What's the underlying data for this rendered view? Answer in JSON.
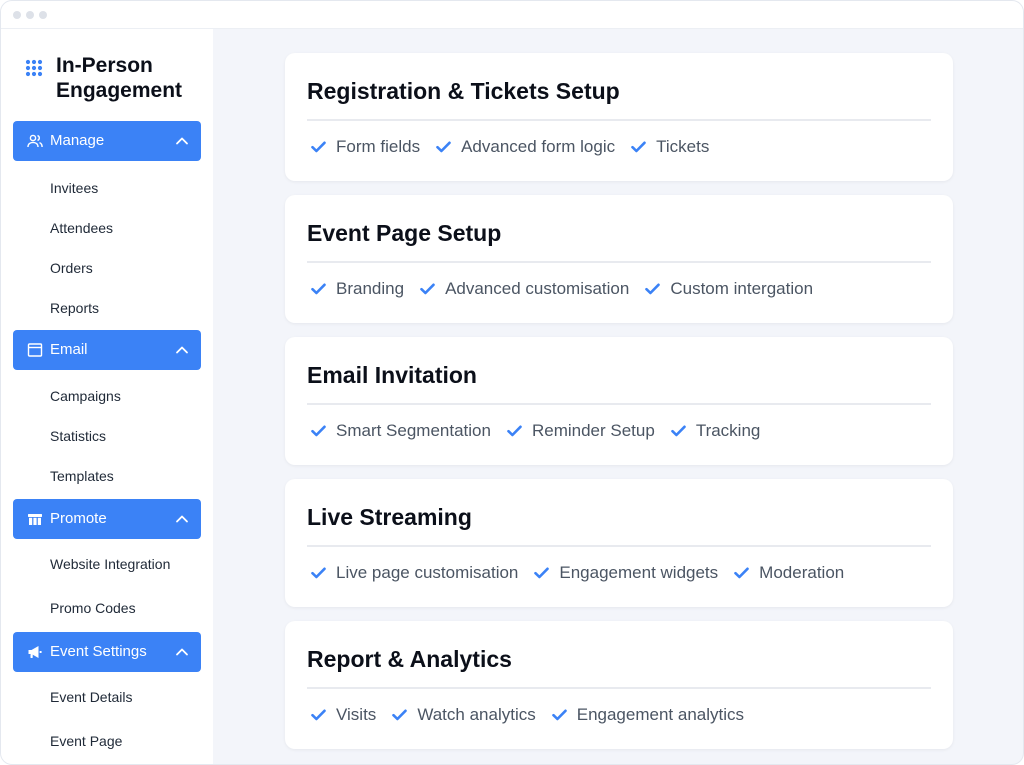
{
  "app": {
    "title": "In-Person Engagement",
    "accent_color": "#3b82f6",
    "check_color": "#3b82f6"
  },
  "sidebar": {
    "sections": [
      {
        "label": "Manage",
        "icon": "users-icon",
        "items": [
          "Invitees",
          "Attendees",
          "Orders",
          "Reports"
        ]
      },
      {
        "label": "Email",
        "icon": "browser-window-icon",
        "items": [
          "Campaigns",
          "Statistics",
          "Templates"
        ]
      },
      {
        "label": "Promote",
        "icon": "store-icon",
        "items": [
          "Website Integration",
          "Promo Codes"
        ]
      },
      {
        "label": "Event Settings",
        "icon": "megaphone-icon",
        "items": [
          "Event Details",
          "Event Page"
        ]
      }
    ]
  },
  "main": {
    "cards": [
      {
        "title": "Registration & Tickets Setup",
        "features": [
          "Form fields",
          "Advanced form logic",
          "Tickets"
        ]
      },
      {
        "title": "Event Page Setup",
        "features": [
          "Branding",
          "Advanced customisation",
          "Custom intergation"
        ]
      },
      {
        "title": "Email Invitation",
        "features": [
          "Smart Segmentation",
          "Reminder Setup",
          "Tracking"
        ]
      },
      {
        "title": "Live Streaming",
        "features": [
          "Live page customisation",
          "Engagement widgets",
          "Moderation"
        ]
      },
      {
        "title": "Report & Analytics",
        "features": [
          "Visits",
          "Watch analytics",
          "Engagement analytics"
        ]
      }
    ]
  }
}
